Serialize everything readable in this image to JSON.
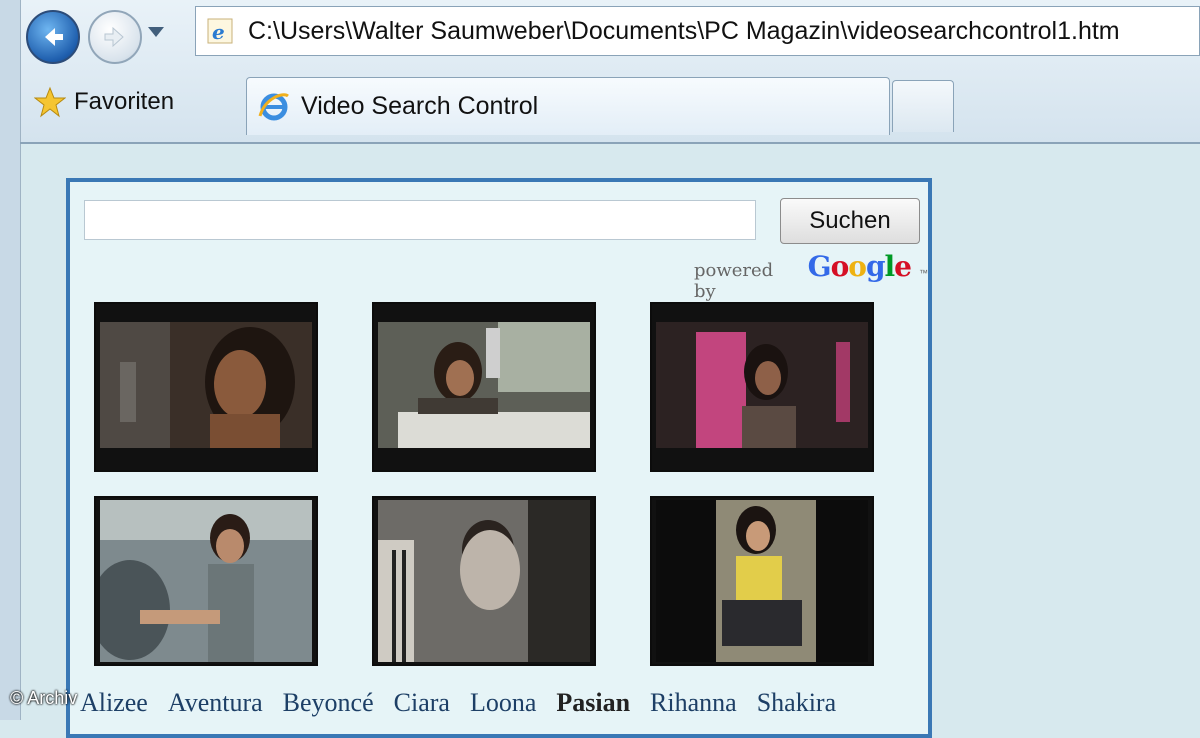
{
  "browser": {
    "address_url": "C:\\Users\\Walter Saumweber\\Documents\\PC Magazin\\videosearchcontrol1.htm",
    "favorites_label": "Favoriten",
    "tab_title": "Video Search Control"
  },
  "search": {
    "input_value": "",
    "button_label": "Suchen",
    "powered_by": "powered by",
    "google_letters": [
      "G",
      "o",
      "o",
      "g",
      "l",
      "e"
    ],
    "google_colors": [
      "#3369e8",
      "#d50f25",
      "#eeb211",
      "#3369e8",
      "#009925",
      "#d50f25"
    ],
    "trademark": "™"
  },
  "videos": [
    {
      "name": "video-thumb-1"
    },
    {
      "name": "video-thumb-2"
    },
    {
      "name": "video-thumb-3"
    },
    {
      "name": "video-thumb-4"
    },
    {
      "name": "video-thumb-5"
    },
    {
      "name": "video-thumb-6"
    }
  ],
  "tags": [
    "Alizee",
    "Aventura",
    "Beyoncé",
    "Ciara",
    "Loona",
    "Pasian",
    "Rihanna",
    "Shakira"
  ],
  "current_tag": "Pasian",
  "watermark": "© Archiv",
  "colors": {
    "widget_border": "#3a78b5",
    "page_background": "#d7e9ee",
    "link_color": "#1d3f66"
  }
}
